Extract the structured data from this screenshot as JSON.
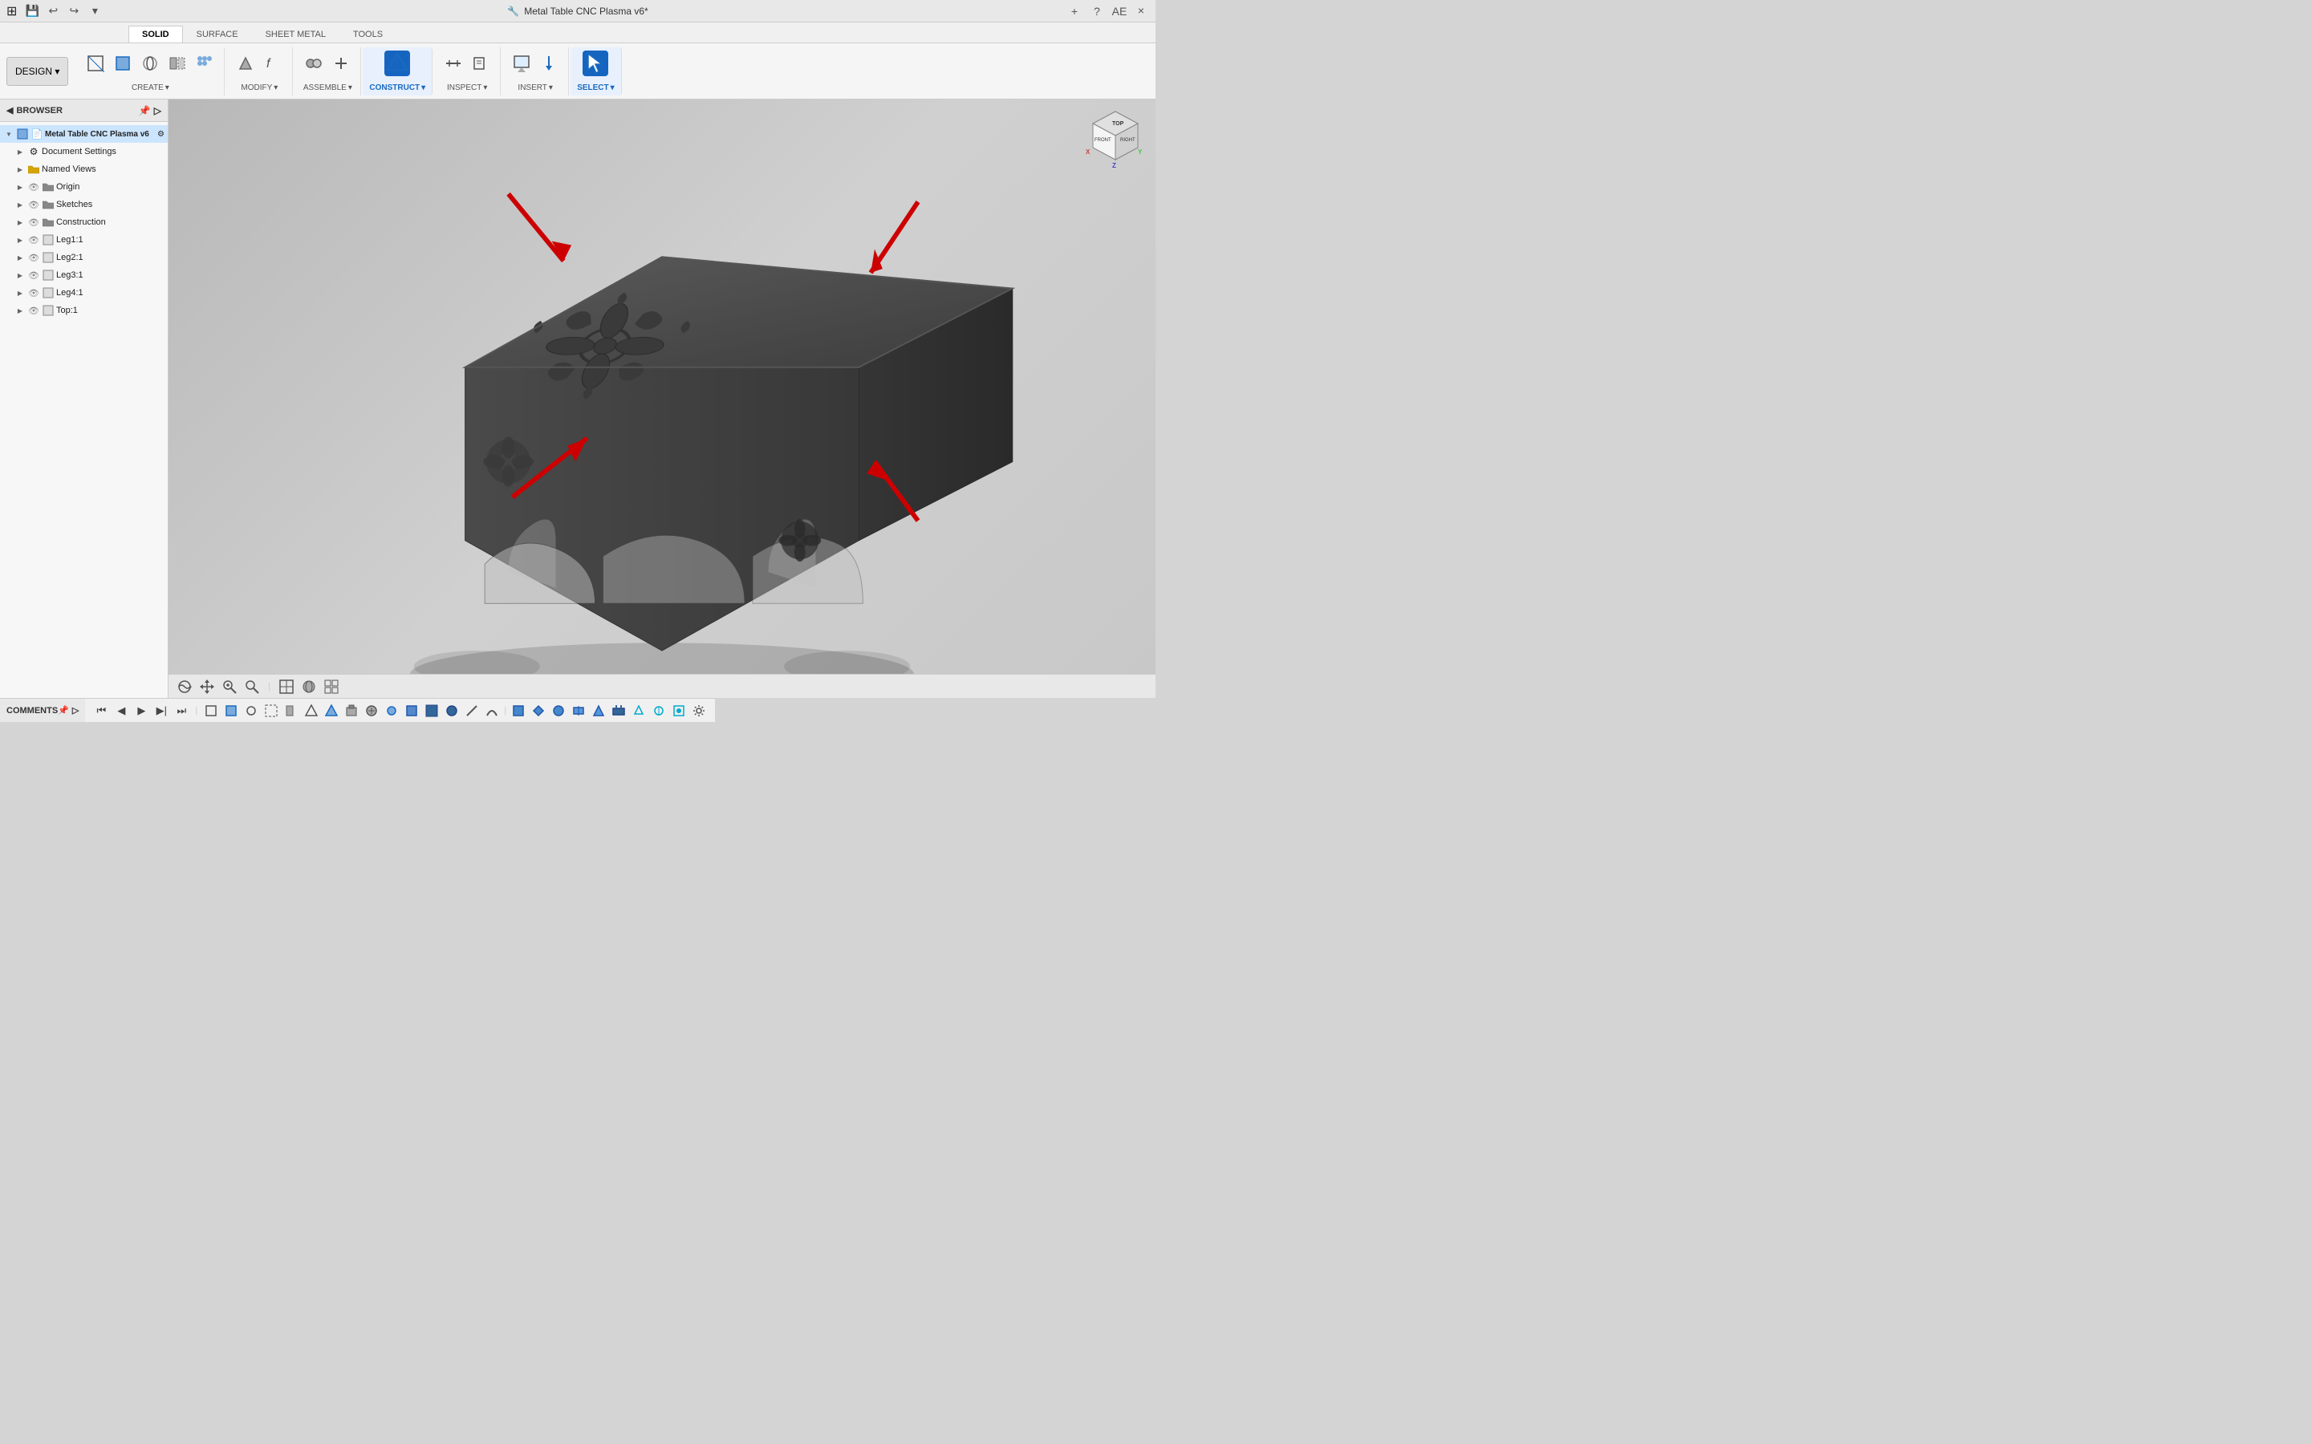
{
  "titleBar": {
    "title": "Metal Table CNC Plasma v6*",
    "closeBtn": "×",
    "addTabBtn": "+",
    "windowIcon": "⚙"
  },
  "tabs": {
    "items": [
      "SOLID",
      "SURFACE",
      "SHEET METAL",
      "TOOLS"
    ],
    "active": 0
  },
  "toolbar": {
    "designBtn": "DESIGN ▾",
    "groups": [
      {
        "label": "CREATE ▾",
        "icons": [
          "⬜",
          "◼",
          "⭕",
          "⊞",
          "✦"
        ]
      },
      {
        "label": "MODIFY ▾",
        "icons": [
          "⬡",
          "ƒ"
        ]
      },
      {
        "label": "ASSEMBLE ▾",
        "icons": [
          "⚙",
          "📎"
        ]
      },
      {
        "label": "CONSTRUCT ▾",
        "icons": [
          "🔷"
        ],
        "active": true
      },
      {
        "label": "INSPECT ▾",
        "icons": [
          "📏",
          "🔍"
        ]
      },
      {
        "label": "INSERT ▾",
        "icons": [
          "🖼",
          "📍"
        ]
      },
      {
        "label": "SELECT ▾",
        "icons": [
          "↖"
        ],
        "active": true
      }
    ]
  },
  "browser": {
    "title": "BROWSER",
    "root": {
      "label": "Metal Table CNC Plasma v6",
      "icon": "📄",
      "children": [
        {
          "label": "Document Settings",
          "icon": "⚙",
          "level": 1
        },
        {
          "label": "Named Views",
          "icon": "📁",
          "level": 1
        },
        {
          "label": "Origin",
          "icon": "📁",
          "level": 1,
          "hasEye": true
        },
        {
          "label": "Sketches",
          "icon": "📁",
          "level": 1,
          "hasEye": true
        },
        {
          "label": "Construction",
          "icon": "📁",
          "level": 1,
          "hasEye": true
        },
        {
          "label": "Leg1:1",
          "icon": "⬜",
          "level": 1,
          "hasEye": true
        },
        {
          "label": "Leg2:1",
          "icon": "⬜",
          "level": 1,
          "hasEye": true
        },
        {
          "label": "Leg3:1",
          "icon": "⬜",
          "level": 1,
          "hasEye": true
        },
        {
          "label": "Leg4:1",
          "icon": "⬜",
          "level": 1,
          "hasEye": true
        },
        {
          "label": "Top:1",
          "icon": "⬜",
          "level": 1,
          "hasEye": true
        }
      ]
    }
  },
  "comments": {
    "label": "COMMENTS"
  },
  "viewport": {
    "backgroundColor": "#c8c8c8"
  },
  "bottomBar": {
    "gearIcon": "⚙"
  },
  "footerNav": {
    "buttons": [
      "⏮",
      "◀",
      "▶",
      "▶|",
      "⏭"
    ]
  }
}
